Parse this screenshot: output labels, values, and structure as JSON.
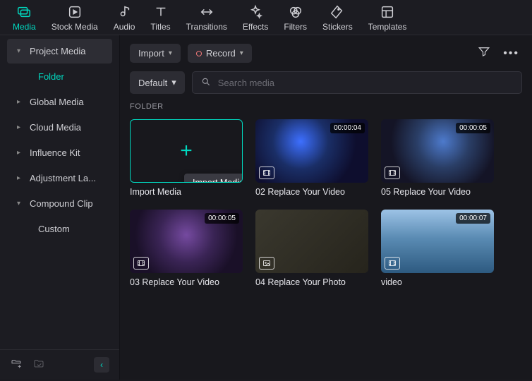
{
  "topnav": [
    {
      "label": "Media",
      "icon": "media",
      "active": true
    },
    {
      "label": "Stock Media",
      "icon": "stock",
      "active": false
    },
    {
      "label": "Audio",
      "icon": "audio",
      "active": false
    },
    {
      "label": "Titles",
      "icon": "titles",
      "active": false
    },
    {
      "label": "Transitions",
      "icon": "transitions",
      "active": false
    },
    {
      "label": "Effects",
      "icon": "effects",
      "active": false
    },
    {
      "label": "Filters",
      "icon": "filters",
      "active": false
    },
    {
      "label": "Stickers",
      "icon": "stickers",
      "active": false
    },
    {
      "label": "Templates",
      "icon": "templates",
      "active": false
    }
  ],
  "sidebar": {
    "items": [
      {
        "label": "Project Media",
        "expanded": true,
        "children": [
          {
            "label": "Folder",
            "active": true
          }
        ]
      },
      {
        "label": "Global Media",
        "expanded": false
      },
      {
        "label": "Cloud Media",
        "expanded": false
      },
      {
        "label": "Influence Kit",
        "expanded": false
      },
      {
        "label": "Adjustment La...",
        "expanded": false
      },
      {
        "label": "Compound Clip",
        "expanded": true,
        "children": [
          {
            "label": "Custom",
            "active": false
          }
        ]
      }
    ]
  },
  "toolbar": {
    "import_label": "Import",
    "record_label": "Record"
  },
  "search": {
    "sort_label": "Default",
    "placeholder": "Search media"
  },
  "section_label": "FOLDER",
  "tooltip_import": "Import Media",
  "cards": [
    {
      "kind": "add",
      "title": "Import Media"
    },
    {
      "kind": "video",
      "title": "02 Replace Your Video",
      "duration": "00:00:04",
      "bg": "bg-concert"
    },
    {
      "kind": "video",
      "title": "05 Replace Your Video",
      "duration": "00:00:05",
      "bg": "bg-singer"
    },
    {
      "kind": "video",
      "title": "03 Replace Your Video",
      "duration": "00:00:05",
      "bg": "bg-party"
    },
    {
      "kind": "photo",
      "title": "04 Replace Your Photo",
      "bg": "bg-band"
    },
    {
      "kind": "video",
      "title": "video",
      "duration": "00:00:07",
      "bg": "bg-sea"
    }
  ]
}
